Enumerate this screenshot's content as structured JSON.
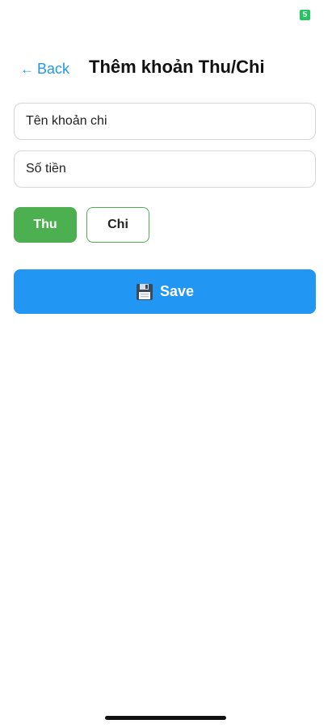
{
  "status_bar": {
    "indicator_text": "5"
  },
  "header": {
    "back_arrow": "←",
    "back_label": "Back",
    "title": "Thêm khoản Thu/Chi"
  },
  "form": {
    "name_placeholder": "Tên khoản chi",
    "name_value": "",
    "amount_placeholder": "Số tiền",
    "amount_value": ""
  },
  "type_toggle": {
    "income_label": "Thu",
    "expense_label": "Chi",
    "selected": "Thu"
  },
  "save": {
    "icon": "floppy-disk-icon",
    "label": "Save"
  },
  "colors": {
    "accent_blue": "#2196F3",
    "income_green": "#4CAF50",
    "status_green": "#22c55e"
  }
}
